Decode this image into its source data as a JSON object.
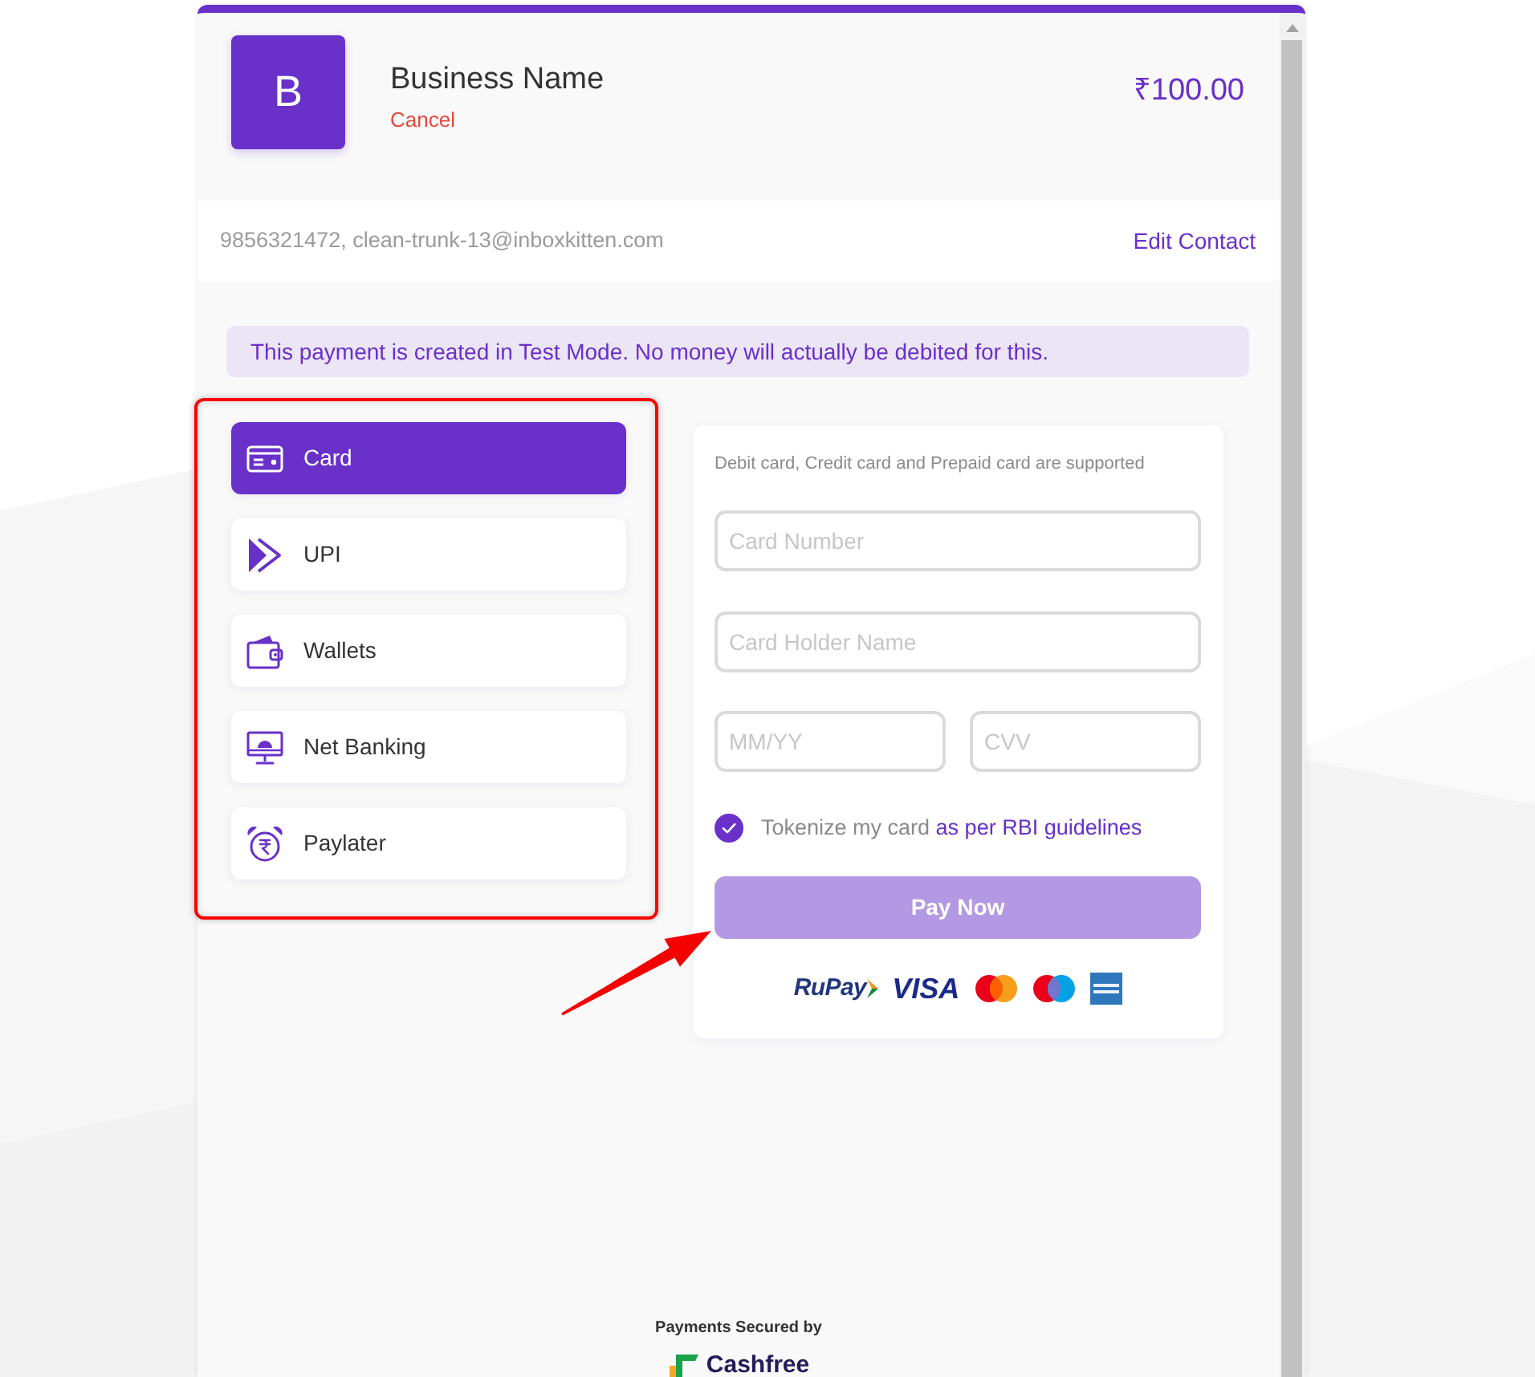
{
  "header": {
    "logo_letter": "B",
    "business_name": "Business Name",
    "cancel": "Cancel",
    "amount": "₹100.00"
  },
  "contact": {
    "details": "9856321472, clean-trunk-13@inboxkitten.com",
    "edit_link": "Edit Contact"
  },
  "notice": "This payment is created in Test Mode. No money will actually be debited for this.",
  "payment_methods": [
    {
      "kind": "card",
      "label": "Card",
      "selected": true
    },
    {
      "kind": "upi",
      "label": "UPI",
      "selected": false
    },
    {
      "kind": "wallet",
      "label": "Wallets",
      "selected": false
    },
    {
      "kind": "netbanking",
      "label": "Net Banking",
      "selected": false
    },
    {
      "kind": "paylater",
      "label": "Paylater",
      "selected": false
    }
  ],
  "card_form": {
    "hint": "Debit card, Credit card and Prepaid card are supported",
    "card_number": {
      "placeholder": "Card Number"
    },
    "holder_name": {
      "placeholder": "Card Holder Name"
    },
    "expiry": {
      "placeholder": "MM/YY"
    },
    "cvv": {
      "placeholder": "CVV"
    },
    "tokenize": {
      "checked": true,
      "label": "Tokenize my card",
      "link": "as per RBI guidelines"
    },
    "pay_button": {
      "label": "Pay Now",
      "disabled": true
    },
    "card_brands": [
      {
        "kind": "rupay",
        "label": "RuPay"
      },
      {
        "kind": "visa",
        "label": "VISA"
      },
      {
        "kind": "mastercard"
      },
      {
        "kind": "maestro"
      },
      {
        "kind": "amex"
      }
    ]
  },
  "footer": {
    "caption": "Payments Secured by",
    "brand": "Cashfree"
  }
}
